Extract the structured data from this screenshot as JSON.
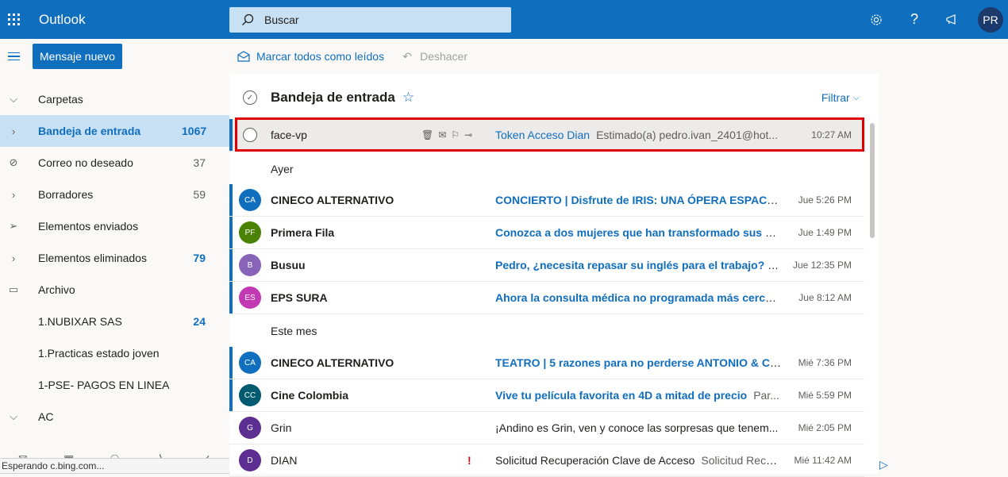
{
  "app": {
    "title": "Outlook"
  },
  "search": {
    "placeholder": "Buscar"
  },
  "header_icons": [
    "gear-icon",
    "help-icon",
    "megaphone-icon"
  ],
  "user": {
    "initials": "PR"
  },
  "left": {
    "new_message": "Mensaje nuevo",
    "folders_label": "Carpetas",
    "folders": [
      {
        "label": "Bandeja de entrada",
        "count": "1067",
        "icon": "chevron-right-icon",
        "selected": true
      },
      {
        "label": "Correo no deseado",
        "count": "37",
        "icon": "block-icon"
      },
      {
        "label": "Borradores",
        "count": "59",
        "icon": "chevron-right-icon"
      },
      {
        "label": "Elementos enviados",
        "count": "",
        "icon": "send-icon"
      },
      {
        "label": "Elementos eliminados",
        "count": "79",
        "icon": "chevron-right-icon"
      },
      {
        "label": "Archivo",
        "count": "",
        "icon": "archive-icon"
      },
      {
        "label": "1.NUBIXAR SAS",
        "count": "24",
        "icon": ""
      },
      {
        "label": "1.Practicas estado joven",
        "count": "",
        "icon": ""
      },
      {
        "label": "1-PSE- PAGOS EN LINEA",
        "count": "",
        "icon": ""
      },
      {
        "label": "AC",
        "count": "",
        "icon": "chevron-down-icon"
      }
    ],
    "bottom_apps": [
      "mail-icon",
      "calendar-icon",
      "people-icon",
      "attachment-icon",
      "todo-icon"
    ]
  },
  "statusbar": {
    "text": "Esperando c.bing.com..."
  },
  "command": {
    "mark_all_read": "Marcar todos como leídos",
    "undo": "Deshacer"
  },
  "list": {
    "title": "Bandeja de entrada",
    "filter": "Filtrar",
    "groups": {
      "yesterday": "Ayer",
      "this_month": "Este mes"
    },
    "selected": {
      "sender": "face-vp",
      "subject": "Token Acceso Dian",
      "preview": "Estimado(a) pedro.ivan_2401@hot...",
      "time": "10:27 AM"
    },
    "messages": [
      {
        "initials": "CA",
        "color": "#106ebe",
        "sender": "CINECO ALTERNATIVO",
        "subject": "CONCIERTO | Disfrute de IRIS: UNA ÓPERA ESPACIAL ...",
        "preview": "",
        "time": "Jue 5:26 PM",
        "unread": true
      },
      {
        "initials": "PF",
        "color": "#498205",
        "sender": "Primera Fila",
        "subject": "Conozca a dos mujeres que han transformado sus co...",
        "preview": "",
        "time": "Jue 1:49 PM",
        "unread": true
      },
      {
        "initials": "B",
        "color": "#8764b8",
        "sender": "Busuu",
        "subject": "Pedro, ¿necesita repasar su inglés para el trabajo? 💼",
        "preview": "",
        "time": "Jue 12:35 PM",
        "unread": true
      },
      {
        "initials": "ES",
        "color": "#c239b3",
        "sender": "EPS SURA",
        "subject": "Ahora la consulta médica no programada más cerca d...",
        "preview": "",
        "time": "Jue 8:12 AM",
        "unread": true
      },
      {
        "initials": "CA",
        "color": "#106ebe",
        "sender": "CINECO ALTERNATIVO",
        "subject": "TEATRO | 5 razones para no perderse ANTONIO & CL...",
        "preview": "",
        "time": "Mié 7:36 PM",
        "unread": true
      },
      {
        "initials": "CC",
        "color": "#005b70",
        "sender": "Cine Colombia",
        "subject": "Vive tu película favorita en 4D a mitad de precio",
        "preview": "Par...",
        "time": "Mié 5:59 PM",
        "unread": true
      },
      {
        "initials": "G",
        "color": "#5c2e91",
        "sender": "Grin",
        "subject": "¡Andino es Grin, ven y conoce las sorpresas que tenem...",
        "preview": "",
        "time": "Mié 2:05 PM",
        "unread": false
      },
      {
        "initials": "D",
        "color": "#5c2e91",
        "sender": "DIAN",
        "subject": "Solicitud Recuperación Clave de Acceso",
        "preview": "Solicitud Recu...",
        "time": "Mié 11:42 AM",
        "unread": false,
        "important": "!"
      }
    ]
  }
}
